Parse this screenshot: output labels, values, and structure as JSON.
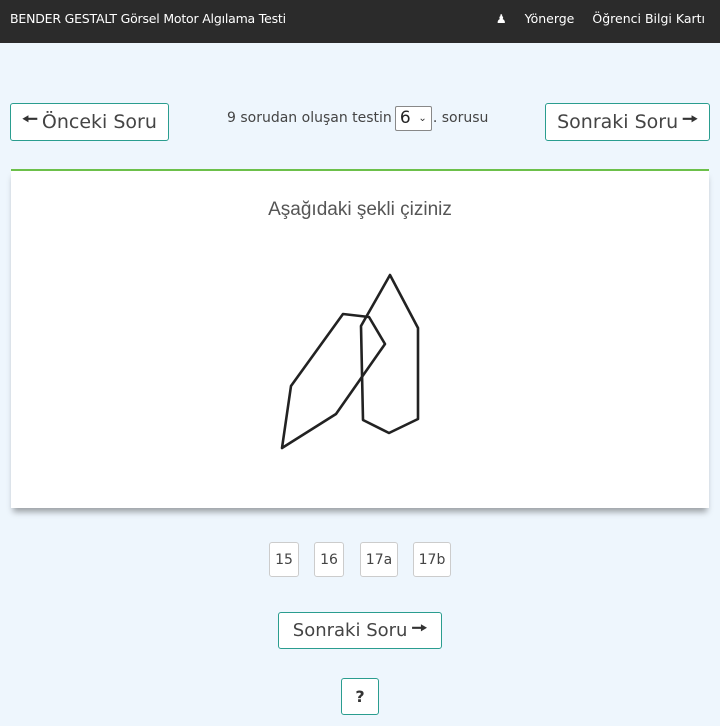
{
  "header": {
    "title": "BENDER GESTALT Görsel Motor Algılama Testi",
    "nav": {
      "person_icon": "person-icon",
      "directions": "Yönerge",
      "student_card": "Öğrenci Bilgi Kartı"
    }
  },
  "navigation": {
    "prev_label": "Önceki Soru",
    "next_label": "Sonraki Soru",
    "counter_prefix": "9 sorudan oluşan testin",
    "current_question": "6",
    "counter_suffix": ". sorusu"
  },
  "question": {
    "title": "Aşağıdaki şekli çiziniz"
  },
  "answer_options": [
    "15",
    "16",
    "17a",
    "17b"
  ],
  "footer": {
    "next_label": "Sonraki Soru",
    "help_label": "?"
  },
  "colors": {
    "header_bg": "#2b2b2b",
    "page_bg": "#eef6fd",
    "accent_border": "#2a9d8f",
    "card_top_border": "#6cc04a"
  }
}
